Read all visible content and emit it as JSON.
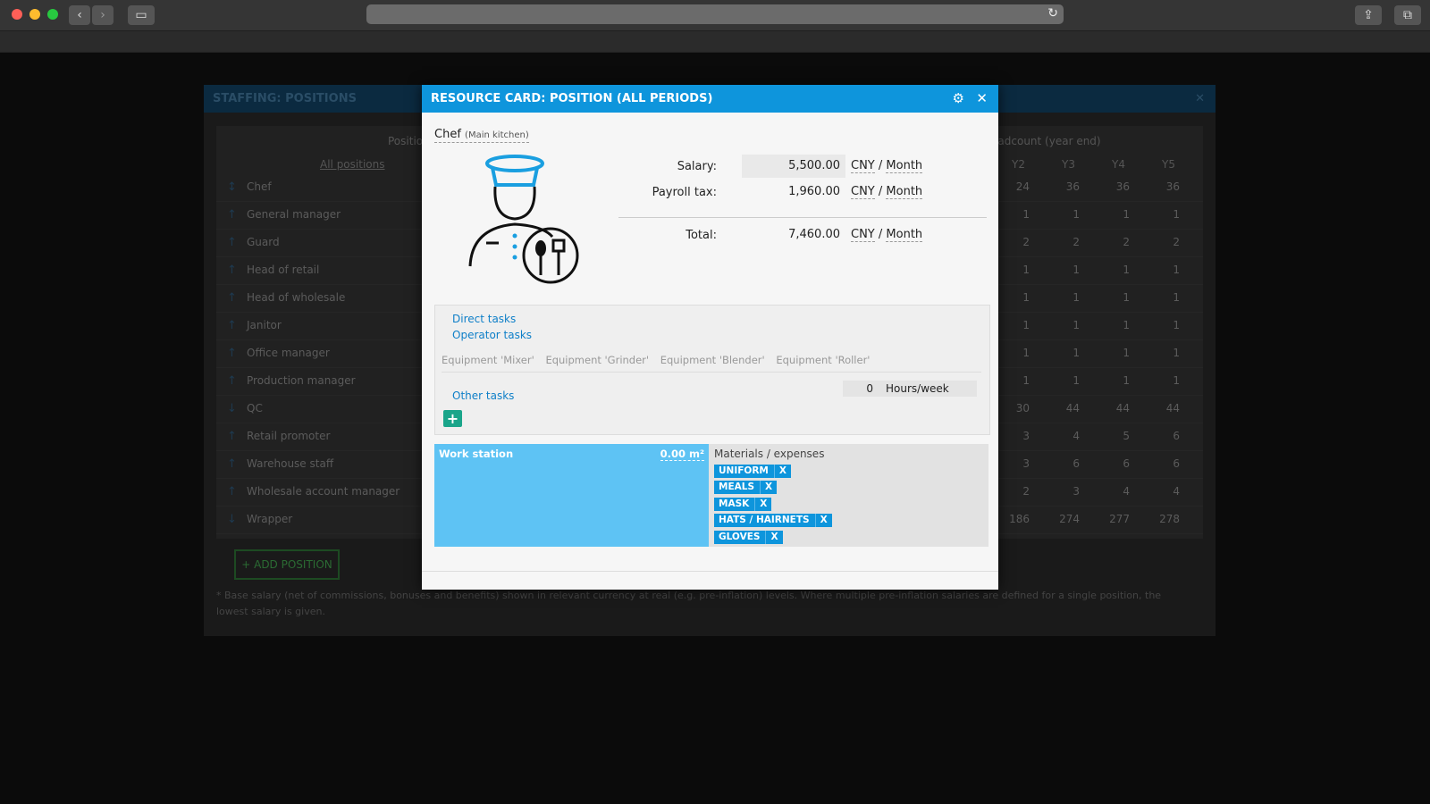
{
  "background": {
    "window_title": "STAFFING: POSITIONS",
    "col_position": "Positio",
    "col_all_positions": "All positions",
    "col_headcount": "Headcount (year end)",
    "year_headers": [
      "Y2",
      "Y3",
      "Y4",
      "Y5"
    ],
    "rows": [
      {
        "name": "Chef",
        "values": [
          "24",
          "36",
          "36",
          "36"
        ]
      },
      {
        "name": "General manager",
        "values": [
          "1",
          "1",
          "1",
          "1"
        ]
      },
      {
        "name": "Guard",
        "values": [
          "2",
          "2",
          "2",
          "2"
        ]
      },
      {
        "name": "Head of retail",
        "values": [
          "1",
          "1",
          "1",
          "1"
        ]
      },
      {
        "name": "Head of wholesale",
        "values": [
          "1",
          "1",
          "1",
          "1"
        ]
      },
      {
        "name": "Janitor",
        "values": [
          "1",
          "1",
          "1",
          "1"
        ]
      },
      {
        "name": "Office manager",
        "values": [
          "1",
          "1",
          "1",
          "1"
        ]
      },
      {
        "name": "Production manager",
        "values": [
          "1",
          "1",
          "1",
          "1"
        ]
      },
      {
        "name": "QC",
        "values": [
          "30",
          "44",
          "44",
          "44"
        ]
      },
      {
        "name": "Retail promoter",
        "values": [
          "3",
          "4",
          "5",
          "6"
        ]
      },
      {
        "name": "Warehouse staff",
        "values": [
          "3",
          "6",
          "6",
          "6"
        ]
      },
      {
        "name": "Wholesale account manager",
        "values": [
          "2",
          "3",
          "4",
          "4"
        ]
      },
      {
        "name": "Wrapper",
        "values": [
          "186",
          "274",
          "277",
          "278"
        ]
      }
    ],
    "add_position_label": "+ ADD POSITION",
    "footnote": "* Base salary (net of commissions, bonuses and benefits) shown in relevant currency at real (e.g. pre-inflation) levels. Where multiple pre-inflation salaries are defined for a single position, the lowest salary is given."
  },
  "modal": {
    "title": "RESOURCE CARD: POSITION (ALL PERIODS)",
    "position_name": "Chef",
    "position_location": "(Main kitchen)",
    "salary_label": "Salary:",
    "salary_value": "5,500.00",
    "payroll_label": "Payroll tax:",
    "payroll_value": "1,960.00",
    "total_label": "Total:",
    "total_value": "7,460.00",
    "currency": "CNY",
    "period_sep": "/",
    "period": "Month",
    "direct_tasks": "Direct tasks",
    "operator_tasks": "Operator tasks",
    "equipment": [
      "Equipment 'Mixer'",
      "Equipment 'Grinder'",
      "Equipment 'Blender'",
      "Equipment 'Roller'"
    ],
    "other_tasks": "Other tasks",
    "hours_value": "0",
    "hours_unit": "Hours/week",
    "workstation_label": "Work station",
    "workstation_value": "0.00 m²",
    "materials_label": "Materials / expenses",
    "materials": [
      "UNIFORM",
      "MEALS",
      "MASK",
      "HATS / HAIRNETS",
      "GLOVES"
    ],
    "remove_label": "X"
  }
}
